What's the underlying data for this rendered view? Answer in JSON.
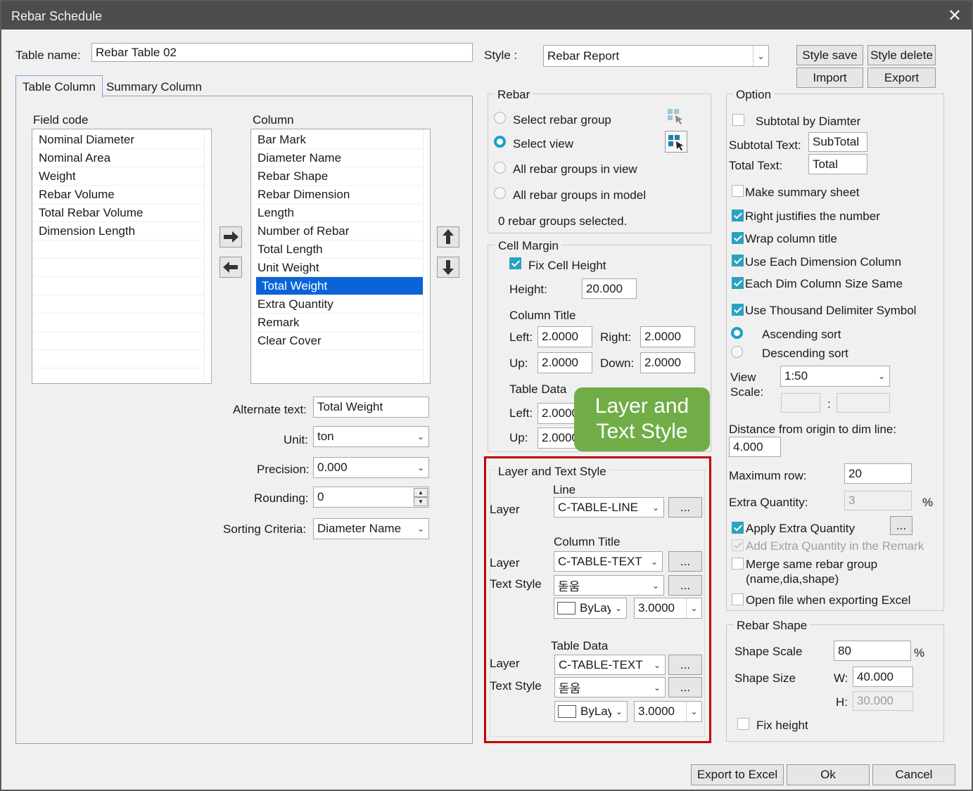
{
  "window": {
    "title": "Rebar Schedule",
    "close_glyph": "✕"
  },
  "table_name": {
    "label": "Table name:",
    "value": "Rebar Table 02"
  },
  "style": {
    "label": "Style :",
    "value": "Rebar Report",
    "save": "Style save",
    "delete": "Style delete",
    "import": "Import",
    "export": "Export"
  },
  "tabs": [
    {
      "label": "Table Column",
      "active": true
    },
    {
      "label": "Summary Column",
      "active": false
    }
  ],
  "field_code": {
    "title": "Field code",
    "items": [
      "Nominal Diameter",
      "Nominal Area",
      "Weight",
      "Rebar Volume",
      "Total Rebar Volume",
      "Dimension Length"
    ]
  },
  "column": {
    "title": "Column",
    "items": [
      "Bar Mark",
      "Diameter Name",
      "Rebar Shape",
      "Rebar Dimension",
      "Length",
      "Number of Rebar",
      "Total Length",
      "Unit Weight",
      "Total Weight",
      "Extra Quantity",
      "Remark",
      "Clear Cover"
    ],
    "selected": "Total Weight"
  },
  "props": {
    "alternate_text": {
      "label": "Alternate text:",
      "value": "Total Weight"
    },
    "unit": {
      "label": "Unit:",
      "value": "ton"
    },
    "precision": {
      "label": "Precision:",
      "value": "0.000"
    },
    "rounding": {
      "label": "Rounding:",
      "value": "0"
    },
    "sorting": {
      "label": "Sorting Criteria:",
      "value": "Diameter Name"
    }
  },
  "rebar": {
    "title": "Rebar",
    "options": [
      "Select rebar group",
      "Select view",
      "All rebar groups in view",
      "All rebar groups in model"
    ],
    "selected": "Select view",
    "status": "0 rebar groups selected."
  },
  "cell_margin": {
    "title": "Cell Margin",
    "fix_cell_height": "Fix Cell Height",
    "height_label": "Height:",
    "height": "20.000",
    "column_title": "Column Title",
    "left_label": "Left:",
    "right_label": "Right:",
    "up_label": "Up:",
    "down_label": "Down:",
    "ct_left": "2.0000",
    "ct_right": "2.0000",
    "ct_up": "2.0000",
    "ct_down": "2.0000",
    "table_data": "Table Data",
    "td_left": "2.0000",
    "td_up": "2.0000"
  },
  "callout": {
    "line1": "Layer and",
    "line2": "Text Style",
    "color": "#70ad47"
  },
  "layer_text": {
    "title": "Layer and Text Style",
    "line_head": "Line",
    "layer_label": "Layer",
    "text_style_label": "Text Style",
    "line_layer": "C-TABLE-LINE",
    "column_title_head": "Column Title",
    "ct_layer": "C-TABLE-TEXT",
    "ct_style": "돋움",
    "ct_color": "ByLayer",
    "ct_height": "3.0000",
    "table_data_head": "Table Data",
    "td_layer": "C-TABLE-TEXT",
    "td_style": "돋움",
    "td_color": "ByLayer",
    "td_height": "3.0000",
    "more": "...",
    "highlight_color": "#c00000"
  },
  "option": {
    "title": "Option",
    "subtotal_by_diameter": "Subtotal by Diamter",
    "subtotal_text_label": "Subtotal Text:",
    "subtotal_text": "SubTotal",
    "total_text_label": "Total Text:",
    "total_text": "Total",
    "make_summary": "Make summary sheet",
    "right_justify": "Right justifies the number",
    "wrap_title": "Wrap column title",
    "each_dim_column": "Use Each Dimension Column",
    "dim_same": "Each Dim Column Size Same",
    "thousand": "Use Thousand Delimiter Symbol",
    "ascending": "Ascending sort",
    "descending": "Descending sort",
    "view_scale_label1": "View",
    "view_scale_label2": "Scale:",
    "view_scale": "1:50",
    "ratio_sep": ":",
    "distance_label": "Distance from origin to dim line:",
    "distance": "4.000",
    "max_row_label": "Maximum row:",
    "max_row": "20",
    "extra_qty_label": "Extra Quantity:",
    "extra_qty": "3",
    "percent": "%",
    "apply_extra": "Apply Extra Quantity",
    "add_extra_remark": "Add Extra Quantity in the Remark",
    "merge_line1": "Merge same rebar group",
    "merge_line2": "(name,dia,shape)",
    "open_file": "Open file when exporting Excel"
  },
  "rebar_shape": {
    "title": "Rebar Shape",
    "scale_label": "Shape Scale",
    "scale": "80",
    "percent": "%",
    "size_label": "Shape Size",
    "w_label": "W:",
    "w": "40.000",
    "h_label": "H:",
    "h": "30.000",
    "fix_height": "Fix height"
  },
  "footer": {
    "export_excel": "Export to Excel",
    "ok": "Ok",
    "cancel": "Cancel"
  },
  "colors": {
    "titlebar": "#4d4d4d",
    "selection": "#0a64d8",
    "accent": "#1aa0c8"
  }
}
